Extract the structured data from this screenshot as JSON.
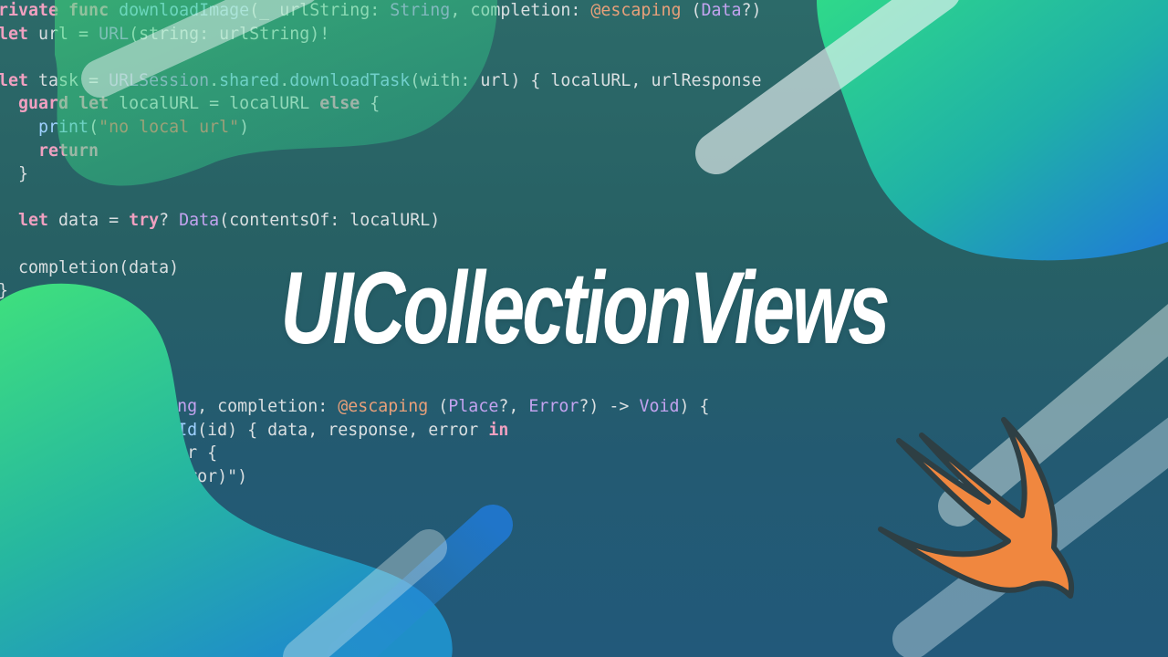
{
  "title": "UICollectionViews",
  "logo": {
    "name": "swift-logo-icon",
    "fill": "#f0873f",
    "outline": "#2e3f44"
  },
  "colors": {
    "background_top": "#2c6a69",
    "background_bottom": "#22597a",
    "blob_green": "#3fe07d",
    "blob_blue": "#1f7ad8",
    "keyword": "#f0a0c0",
    "attribute": "#e8a07a",
    "string": "#f2786d",
    "type": "#c3a3ef",
    "function": "#9fd1ff"
  },
  "code_top": [
    [
      [
        "rivate ",
        "kw"
      ],
      [
        "func ",
        "kw"
      ],
      [
        "downloadImage",
        "fn"
      ],
      [
        "(_ urlString: ",
        "plain"
      ],
      [
        "String",
        "type"
      ],
      [
        ", completion: ",
        "plain"
      ],
      [
        "@escaping",
        "attr"
      ],
      [
        " (",
        "plain"
      ],
      [
        "Data",
        "type"
      ],
      [
        "?)",
        "plain"
      ]
    ],
    [
      [
        "let ",
        "kw"
      ],
      [
        "url = ",
        "plain"
      ],
      [
        "URL",
        "type"
      ],
      [
        "(string: urlString)!",
        "plain"
      ]
    ],
    [],
    [
      [
        "let ",
        "kw"
      ],
      [
        "task = ",
        "plain"
      ],
      [
        "URLSession",
        "type"
      ],
      [
        ".",
        "plain"
      ],
      [
        "shared",
        "fn"
      ],
      [
        ".",
        "plain"
      ],
      [
        "downloadTask",
        "fn"
      ],
      [
        "(with: url) { localURL, urlResponse",
        "plain"
      ]
    ],
    [
      [
        "  guard ",
        "kw"
      ],
      [
        "let ",
        "kw"
      ],
      [
        "localURL = localURL ",
        "plain"
      ],
      [
        "else",
        "kw"
      ],
      [
        " {",
        "plain"
      ]
    ],
    [
      [
        "    print",
        "fn"
      ],
      [
        "(",
        "plain"
      ],
      [
        "\"no local url\"",
        "str"
      ],
      [
        ")",
        "plain"
      ]
    ],
    [
      [
        "    return",
        "kw"
      ]
    ],
    [
      [
        "  }",
        "plain"
      ]
    ],
    [],
    [
      [
        "  let ",
        "kw"
      ],
      [
        "data = ",
        "plain"
      ],
      [
        "try",
        "kw"
      ],
      [
        "? ",
        "plain"
      ],
      [
        "Data",
        "type"
      ],
      [
        "(contentsOf: localURL)",
        "plain"
      ]
    ],
    [],
    [
      [
        "  completion(data)",
        "plain"
      ]
    ],
    [
      [
        "}",
        "plain"
      ]
    ]
  ],
  "code_bottom": [
    [
      [
        "               tring",
        "type"
      ],
      [
        ", completion: ",
        "plain"
      ],
      [
        "@escaping",
        "attr"
      ],
      [
        " (",
        "plain"
      ],
      [
        "Place",
        "type"
      ],
      [
        "?, ",
        "plain"
      ],
      [
        "Error",
        "type"
      ],
      [
        "?) -> ",
        "plain"
      ],
      [
        "Void",
        "type"
      ],
      [
        ") {",
        "plain"
      ]
    ],
    [
      [
        "                thId",
        "fn"
      ],
      [
        "(id) { data, response, error ",
        "plain"
      ],
      [
        "in",
        "kw"
      ]
    ],
    [
      [
        "                rror {",
        "plain"
      ]
    ],
    [
      [
        "                (error)\")",
        "plain"
      ]
    ]
  ]
}
